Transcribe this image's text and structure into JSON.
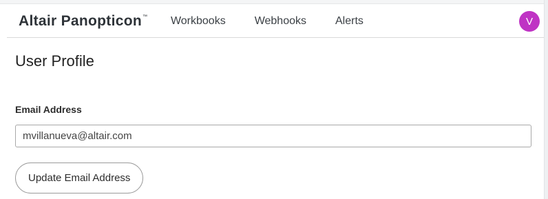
{
  "header": {
    "logo_text": "Altair Panopticon",
    "logo_tm": "™",
    "nav": {
      "workbooks": "Workbooks",
      "webhooks": "Webhooks",
      "alerts": "Alerts"
    },
    "avatar_initial": "V",
    "avatar_color": "#bf33c4"
  },
  "main": {
    "title": "User Profile",
    "email_label": "Email Address",
    "email_value": "mvillanueva@altair.com",
    "update_button_label": "Update Email Address"
  }
}
